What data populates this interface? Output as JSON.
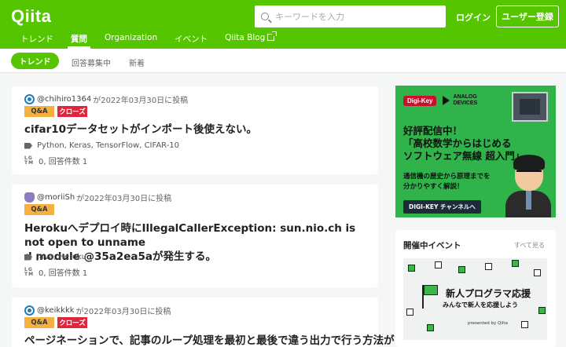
{
  "header": {
    "logo": "Qiita",
    "search_placeholder": "キーワードを入力",
    "login_label": "ログイン",
    "signup_label": "ユーザー登録"
  },
  "nav": {
    "items": [
      {
        "label": "トレンド"
      },
      {
        "label": "質問",
        "active": true
      },
      {
        "label": "Organization"
      },
      {
        "label": "イベント"
      },
      {
        "label": "Qiita Blog",
        "external": true
      }
    ]
  },
  "subnav": {
    "active": "トレンド",
    "items": [
      "回答募集中",
      "新着"
    ]
  },
  "posts": [
    {
      "user": "@chihiro1364",
      "posted": "が2022年03月30日に投稿",
      "badges": [
        "Q&A",
        "クローズ"
      ],
      "title": "cifar10データセットがインポート後使えない。",
      "tags": "Python,  Keras,  TensorFlow,  CIFAR-10",
      "stats": "0,  回答件数  1"
    },
    {
      "user": "@moriiSh",
      "posted": "が2022年03月30日に投稿",
      "badges": [
        "Q&A"
      ],
      "title_line1": "Herokuへデプロイ時にIllegalCallerException: sun.nio.ch is not open to unname",
      "title_line2": "d module @35a2ea5aが発生する。",
      "tags": "Java,  Heroku",
      "stats": "0,  回答件数  1"
    },
    {
      "user": "@keikkkk",
      "posted": "が2022年03月30日に投稿",
      "badges": [
        "Q&A",
        "クローズ"
      ],
      "title": "ページネーションで、記事のループ処理を最初と最後で違う出力で行う方法が"
    }
  ],
  "ad": {
    "brand1": "Digi-Key",
    "brand2_line1": "ANALOG",
    "brand2_line2": "DEVICES",
    "headline_line1": "好評配信中！",
    "headline_line2": "「高校数学からはじめる",
    "headline_line3": "ソフトウェア無線 超入門」",
    "sub_line1": "通信機の歴史から原理までを",
    "sub_line2": "分かりやすく解説！",
    "button": "DIGI-KEY チャンネルへ"
  },
  "events": {
    "title": "開催中イベント",
    "more": "すべて見る",
    "banner_title": "新人プログラマ応援",
    "banner_sub": "みんなで新人を応援しよう",
    "banner_by": "presented by Qiita"
  },
  "colors": {
    "brand_green": "#55c500",
    "qa_badge": "#f6b041",
    "closed_badge": "#e0263c"
  }
}
